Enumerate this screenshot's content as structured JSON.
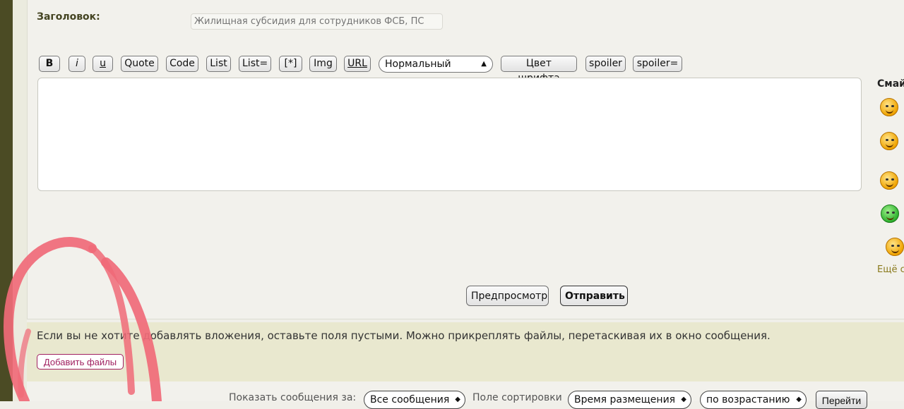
{
  "form": {
    "title_label": "Заголовок:",
    "title_placeholder": "Жилищная субсидия для сотрудников ФСБ, ПС"
  },
  "toolbar": {
    "bold": "B",
    "italic": "i",
    "underline": "u",
    "quote": "Quote",
    "code": "Code",
    "list": "List",
    "list_eq": "List=",
    "list_item": "[*]",
    "img": "Img",
    "url": "URL",
    "size_select": "Нормальный",
    "font_color": "Цвет шрифта",
    "spoiler": "spoiler",
    "spoiler_eq": "spoiler="
  },
  "smileys": {
    "title": "Смай",
    "more": "Ещё с"
  },
  "actions": {
    "preview": "Предпросмотр",
    "submit": "Отправить"
  },
  "attachments": {
    "info": "Если вы не хотите добавлять вложения, оставьте поля пустыми. Можно прикреплять файлы, перетаскивая их в окно сообщения.",
    "add_files": "Добавить файлы"
  },
  "bottom": {
    "show_label": "Показать сообщения за:",
    "show_value": "Все сообщения",
    "sort_label": "Поле сортировки",
    "sort_value": "Время размещения",
    "order_value": "по возрастанию",
    "go": "Перейти"
  },
  "colors": {
    "annotation": "#f06a78",
    "accent_link": "#a02060",
    "sidebar": "#4b4b24"
  }
}
